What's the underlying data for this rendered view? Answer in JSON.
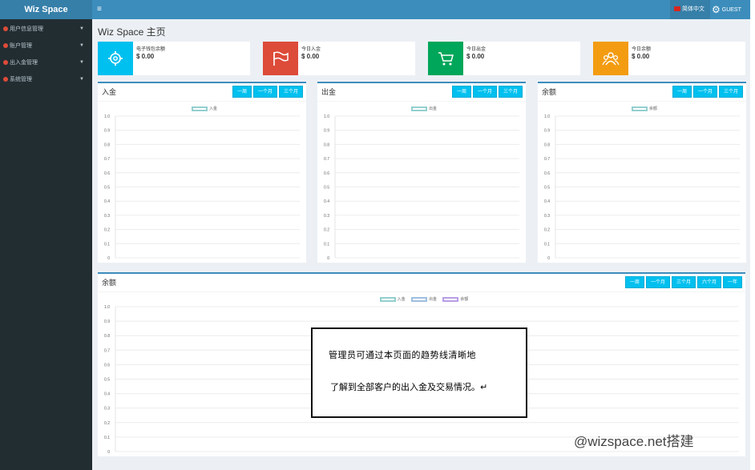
{
  "app": {
    "title": "Wiz Space",
    "menu_glyph": "≡"
  },
  "header": {
    "language": "简体中文",
    "user": "GUEST"
  },
  "sidebar": {
    "items": [
      {
        "label": "用户信息管理"
      },
      {
        "label": "账户管理"
      },
      {
        "label": "出入金管理"
      },
      {
        "label": "系统管理"
      }
    ]
  },
  "page": {
    "title": "Wiz Space 主页"
  },
  "cards": [
    {
      "label": "电子钱包余额",
      "value": "$ 0.00",
      "icon": "gear-icon",
      "color": "#00c0ef"
    },
    {
      "label": "今日入金",
      "value": "$ 0.00",
      "icon": "flag-icon",
      "color": "#dd4b39"
    },
    {
      "label": "今日出金",
      "value": "$ 0.00",
      "icon": "cart-icon",
      "color": "#00a65a"
    },
    {
      "label": "今日余额",
      "value": "$ 0.00",
      "icon": "users-icon",
      "color": "#f39c12"
    }
  ],
  "panels": [
    {
      "title": "入金",
      "buttons": [
        "一周",
        "一个月",
        "三个月"
      ],
      "legend": [
        "入金"
      ]
    },
    {
      "title": "出金",
      "buttons": [
        "一周",
        "一个月",
        "三个月"
      ],
      "legend": [
        "出金"
      ]
    },
    {
      "title": "余额",
      "buttons": [
        "一周",
        "一个月",
        "三个月"
      ],
      "legend": [
        "余额"
      ]
    }
  ],
  "bottom_panel": {
    "title": "余额",
    "buttons": [
      "一周",
      "一个月",
      "三个月",
      "六个月",
      "一年"
    ],
    "legend": [
      "入金",
      "出金",
      "余额"
    ]
  },
  "legend_colors": [
    "#94cfcf",
    "#9fbfe0",
    "#b89ee6"
  ],
  "chart_data": [
    {
      "type": "line",
      "series": [
        {
          "name": "入金",
          "values": []
        }
      ],
      "ylim": [
        0,
        1
      ],
      "yticks": [
        "0",
        "0.1",
        "0.2",
        "0.3",
        "0.4",
        "0.5",
        "0.6",
        "0.7",
        "0.8",
        "0.9",
        "1.0"
      ],
      "grid": true,
      "legend": "top-center"
    },
    {
      "type": "line",
      "series": [
        {
          "name": "出金",
          "values": []
        }
      ],
      "ylim": [
        0,
        1
      ],
      "yticks": [
        "0",
        "0.1",
        "0.2",
        "0.3",
        "0.4",
        "0.5",
        "0.6",
        "0.7",
        "0.8",
        "0.9",
        "1.0"
      ],
      "grid": true,
      "legend": "top-center"
    },
    {
      "type": "line",
      "series": [
        {
          "name": "余额",
          "values": []
        }
      ],
      "ylim": [
        0,
        1
      ],
      "yticks": [
        "0",
        "0.1",
        "0.2",
        "0.3",
        "0.4",
        "0.5",
        "0.6",
        "0.7",
        "0.8",
        "0.9",
        "1.0"
      ],
      "grid": true,
      "legend": "top-center"
    },
    {
      "type": "line",
      "series": [
        {
          "name": "入金",
          "values": []
        },
        {
          "name": "出金",
          "values": []
        },
        {
          "name": "余额",
          "values": []
        }
      ],
      "ylim": [
        0,
        1
      ],
      "yticks": [
        "0",
        "0.1",
        "0.2",
        "0.3",
        "0.4",
        "0.5",
        "0.6",
        "0.7",
        "0.8",
        "0.9",
        "1.0"
      ],
      "grid": true,
      "legend": "top-center"
    }
  ],
  "annotation": {
    "line1": "管理员可通过本页面的趋势线清晰地",
    "line2": "了解到全部客户的出入金及交易情况。↵"
  },
  "watermark": "@wizspace.net搭建"
}
